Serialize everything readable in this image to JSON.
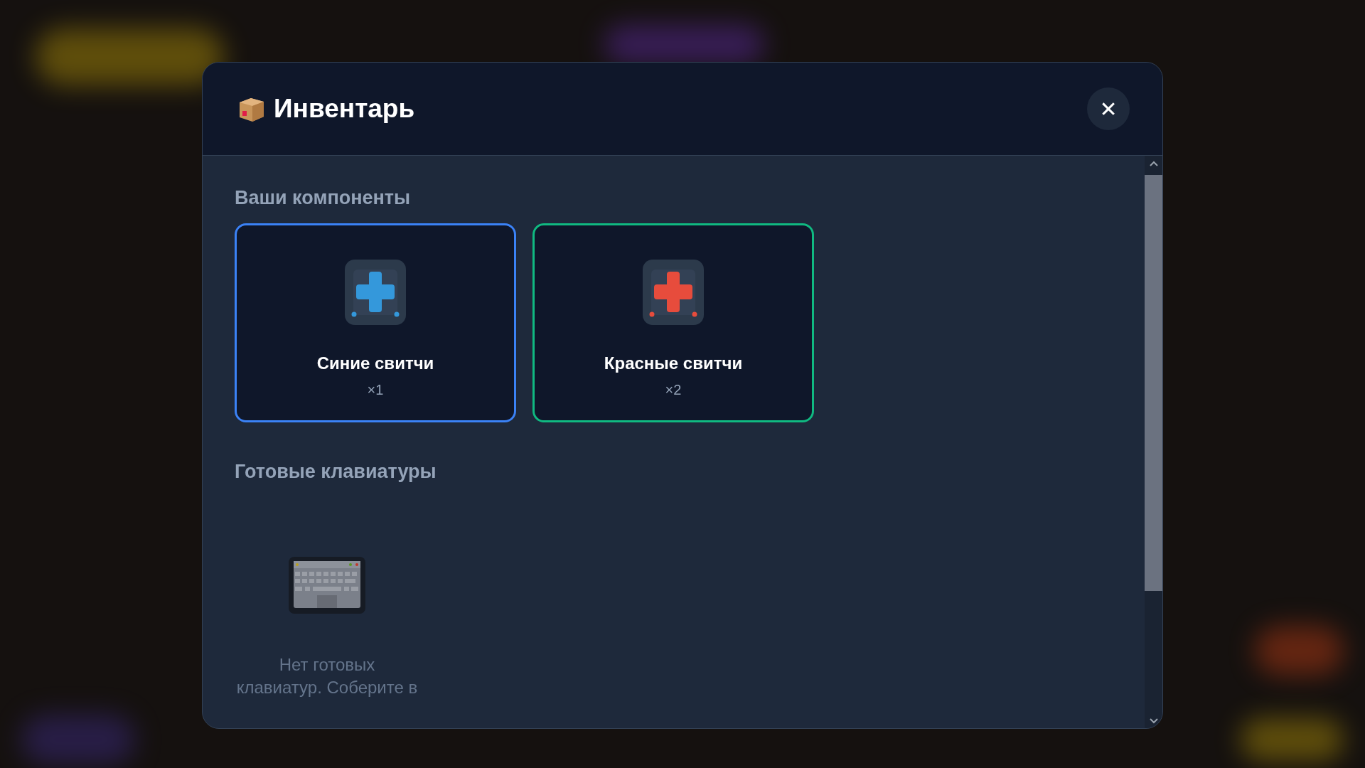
{
  "dialog": {
    "title": "Инвентарь",
    "close_label": "✕"
  },
  "components": {
    "heading": "Ваши компоненты",
    "items": [
      {
        "name": "Синие свитчи",
        "count": "×1",
        "kind": "blue",
        "color": "#3b82f6"
      },
      {
        "name": "Красные свитчи",
        "count": "×2",
        "kind": "red",
        "color": "#10b981"
      }
    ]
  },
  "keyboards": {
    "heading": "Готовые клавиатуры",
    "empty_text": "Нет готовых клавиатур. Соберите в"
  }
}
